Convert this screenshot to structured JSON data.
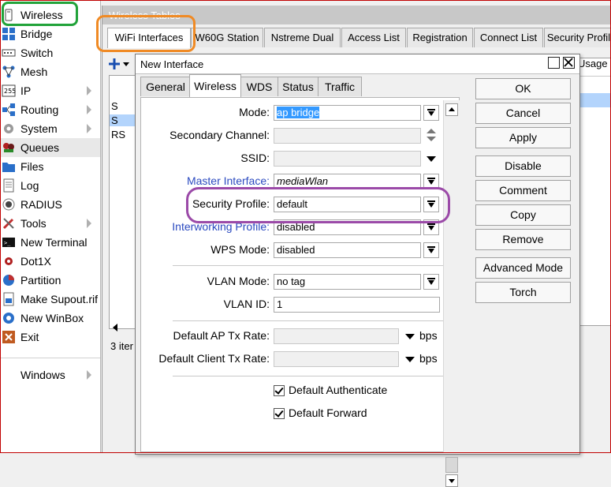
{
  "menu": {
    "items": [
      {
        "label": "Wireless",
        "icon": "wireless-icon",
        "arrow": false
      },
      {
        "label": "Bridge",
        "icon": "bridge-icon",
        "arrow": false
      },
      {
        "label": "Switch",
        "icon": "switch-icon",
        "arrow": false
      },
      {
        "label": "Mesh",
        "icon": "mesh-icon",
        "arrow": false
      },
      {
        "label": "IP",
        "icon": "ip-icon",
        "arrow": true
      },
      {
        "label": "Routing",
        "icon": "routing-icon",
        "arrow": true
      },
      {
        "label": "System",
        "icon": "system-gear-icon",
        "arrow": true
      },
      {
        "label": "Queues",
        "icon": "queues-icon",
        "arrow": false
      },
      {
        "label": "Files",
        "icon": "folder-icon",
        "arrow": false
      },
      {
        "label": "Log",
        "icon": "log-icon",
        "arrow": false
      },
      {
        "label": "RADIUS",
        "icon": "radius-icon",
        "arrow": false
      },
      {
        "label": "Tools",
        "icon": "tools-icon",
        "arrow": true
      },
      {
        "label": "New Terminal",
        "icon": "terminal-icon",
        "arrow": false
      },
      {
        "label": "Dot1X",
        "icon": "dot1x-icon",
        "arrow": false
      },
      {
        "label": "Partition",
        "icon": "partition-icon",
        "arrow": false
      },
      {
        "label": "Make Supout.rif",
        "icon": "supout-icon",
        "arrow": false
      },
      {
        "label": "New WinBox",
        "icon": "winbox-icon",
        "arrow": false
      },
      {
        "label": "Exit",
        "icon": "exit-icon",
        "arrow": false
      }
    ],
    "windows": {
      "label": "Windows"
    }
  },
  "bg_window": {
    "title": "Wireless Tables",
    "tabs": [
      "WiFi Interfaces",
      "W60G Station",
      "Nstreme Dual",
      "Access List",
      "Registration",
      "Connect List",
      "Security Profil"
    ],
    "rows": [
      "S",
      "S",
      "RS"
    ],
    "status": "3 iter",
    "usage": "Usage"
  },
  "dialog": {
    "title": "New Interface",
    "tabs": [
      "General",
      "Wireless",
      "WDS",
      "Status",
      "Traffic"
    ],
    "active_tab": "Wireless",
    "fields": {
      "mode": {
        "label": "Mode:",
        "value": "ap bridge"
      },
      "secondary_channel": {
        "label": "Secondary Channel:",
        "value": ""
      },
      "ssid": {
        "label": "SSID:",
        "value": ""
      },
      "master_interface": {
        "label": "Master Interface:",
        "value": "mediaWlan"
      },
      "security_profile": {
        "label": "Security Profile:",
        "value": "default"
      },
      "interworking_profile": {
        "label": "Interworking Profile:",
        "value": "disabled"
      },
      "wps_mode": {
        "label": "WPS Mode:",
        "value": "disabled"
      },
      "vlan_mode": {
        "label": "VLAN Mode:",
        "value": "no tag"
      },
      "vlan_id": {
        "label": "VLAN ID:",
        "value": "1"
      },
      "default_ap_tx_rate": {
        "label": "Default AP Tx Rate:",
        "value": "",
        "unit": "bps"
      },
      "default_client_tx_rate": {
        "label": "Default Client Tx Rate:",
        "value": "",
        "unit": "bps"
      }
    },
    "checkboxes": {
      "default_authenticate": {
        "label": "Default Authenticate",
        "checked": true
      },
      "default_forward": {
        "label": "Default Forward",
        "checked": true
      }
    },
    "buttons": {
      "ok": "OK",
      "cancel": "Cancel",
      "apply": "Apply",
      "disable": "Disable",
      "comment": "Comment",
      "copy": "Copy",
      "remove": "Remove",
      "advanced_mode": "Advanced Mode",
      "torch": "Torch"
    }
  },
  "annotations": {
    "green": "#22a33a",
    "orange": "#f08a24",
    "purple": "#9b4aa8"
  }
}
